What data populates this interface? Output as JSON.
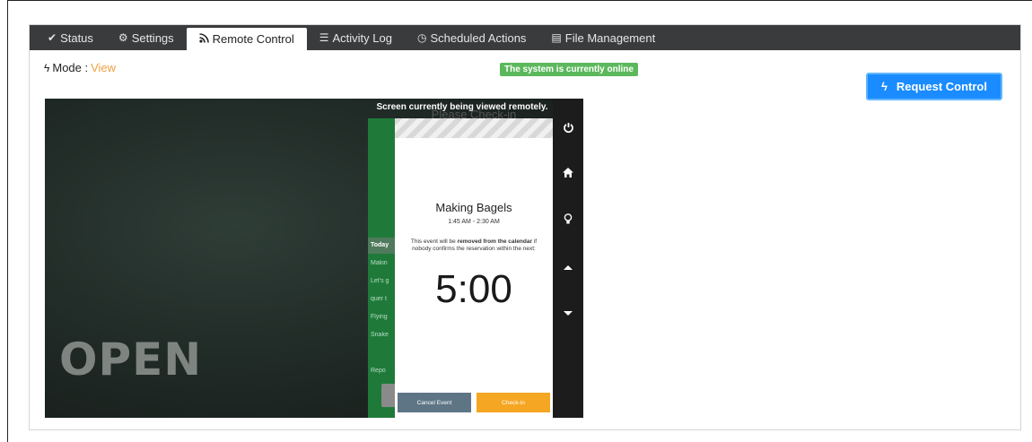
{
  "tabs": [
    {
      "label": "Status",
      "icon": "check-icon",
      "glyph": "✔"
    },
    {
      "label": "Settings",
      "icon": "gear-icon",
      "glyph": "⚙"
    },
    {
      "label": "Remote Control",
      "icon": "rss-icon",
      "glyph": "⚞"
    },
    {
      "label": "Activity Log",
      "icon": "list-icon",
      "glyph": "☰"
    },
    {
      "label": "Scheduled Actions",
      "icon": "clock-icon",
      "glyph": "◷"
    },
    {
      "label": "File Management",
      "icon": "file-icon",
      "glyph": "▤"
    }
  ],
  "active_tab": 2,
  "mode": {
    "label": "Mode :",
    "value": "View",
    "value_color": "#f0a040"
  },
  "status_badge": {
    "text": "The system is currently online",
    "color": "#5cb85c"
  },
  "request_button": {
    "label": "Request Control",
    "color": "#1a8cff"
  },
  "remote_screen": {
    "banner": "Screen currently being viewed remotely.",
    "background_text": "OPEN",
    "list_rows": [
      "Today",
      "Makin",
      "Let's g",
      "quer t",
      "Flying",
      "Snake",
      "Repo"
    ],
    "dialog": {
      "title": "Please Check-in",
      "event_title": "Making Bagels",
      "event_time": "1:45 AM - 2:30 AM",
      "message_pre": "This event will be",
      "message_bold1": "removed from the calendar",
      "message_post": "if nobody confirms the reservation within the next:",
      "countdown": "5:00",
      "cancel_label": "Cancel Event",
      "checkin_label": "Check-in"
    },
    "side_buttons": [
      {
        "icon": "power-icon",
        "glyph": "⏻"
      },
      {
        "icon": "home-icon",
        "glyph": "⌂"
      },
      {
        "icon": "lightbulb-icon",
        "glyph": "♁"
      },
      {
        "icon": "caret-up-icon",
        "glyph": "▲"
      },
      {
        "icon": "caret-down-icon",
        "glyph": "▼"
      }
    ]
  }
}
